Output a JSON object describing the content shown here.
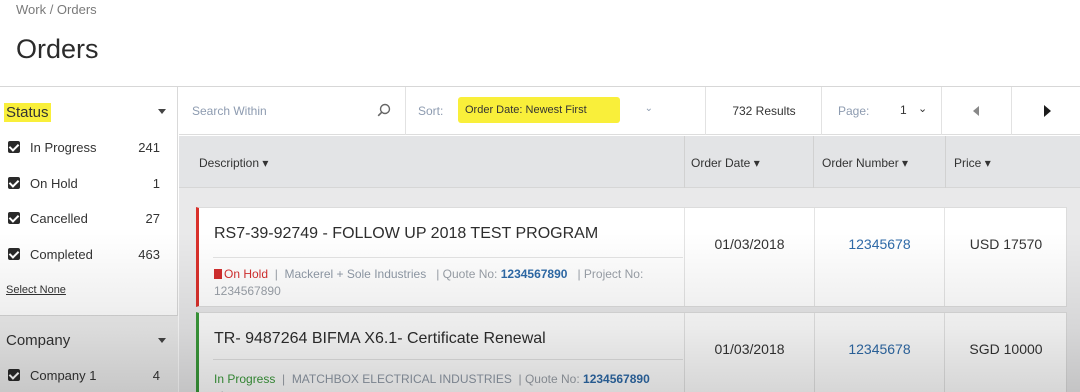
{
  "breadcrumb": "Work / Orders",
  "page_title": "Orders",
  "sidebar": {
    "status": {
      "title": "Status",
      "items": [
        {
          "label": "In Progress",
          "count": "241"
        },
        {
          "label": "On Hold",
          "count": "1"
        },
        {
          "label": "Cancelled",
          "count": "27"
        },
        {
          "label": "Completed",
          "count": "463"
        }
      ],
      "select_none": "Select None"
    },
    "company": {
      "title": "Company",
      "items": [
        {
          "label": "Company 1",
          "count": "4"
        }
      ]
    }
  },
  "toolbar": {
    "search_placeholder": "Search Within",
    "sort_label": "Sort:",
    "sort_value": "Order Date: Newest First",
    "results": "732 Results",
    "page_label": "Page:",
    "page_value": "1"
  },
  "table": {
    "columns": [
      "Description",
      "Order Date",
      "Order Number",
      "Price"
    ]
  },
  "orders": [
    {
      "title": "RS7-39-92749 - FOLLOW UP 2018 TEST PROGRAM",
      "status": "On Hold",
      "company": "Mackerel + Sole Industries",
      "quote_label": "Quote No:",
      "quote_no": "1234567890",
      "project_label": "Project No:",
      "project_no": "1234567890",
      "order_date": "01/03/2018",
      "order_number": "12345678",
      "price": "USD 17570"
    },
    {
      "title": "TR- 9487264 BIFMA X6.1- Certificate Renewal",
      "status": "In Progress",
      "company": "MATCHBOX ELECTRICAL INDUSTRIES",
      "quote_label": "Quote No:",
      "quote_no": "1234567890",
      "order_date": "01/03/2018",
      "order_number": "12345678",
      "price": "SGD 10000"
    }
  ],
  "colors": {
    "highlight": "#f9ef3a",
    "on_hold": "#d32f2f",
    "in_progress": "#3a9a3a",
    "link": "#2e6aa8"
  },
  "icons": [
    "search-icon",
    "caret-down-icon",
    "checkbox-checked-icon",
    "prev-page-icon",
    "next-page-icon",
    "on-hold-icon"
  ]
}
